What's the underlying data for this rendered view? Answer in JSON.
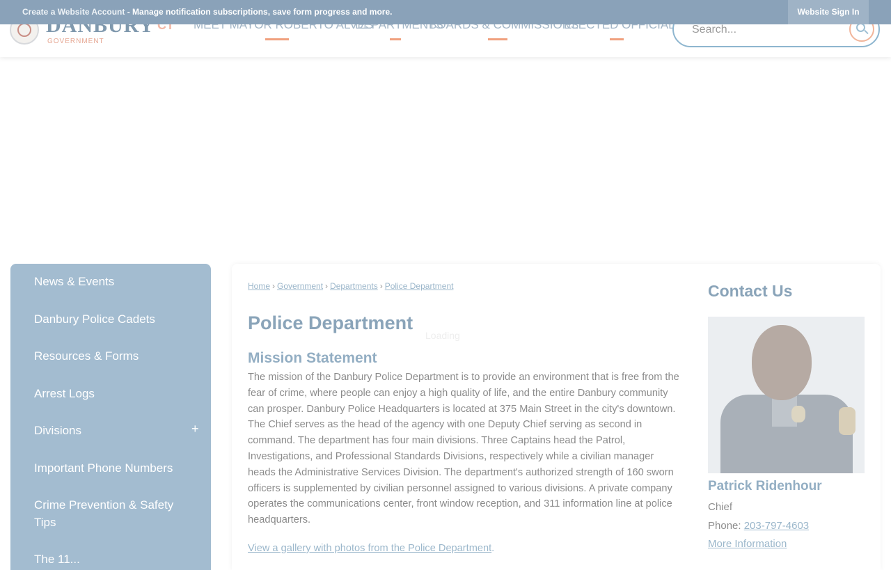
{
  "topbar": {
    "create_account": "Create a Website Account",
    "message": " - Manage notification subscriptions, save form progress and more.",
    "sign_in": "Website Sign In"
  },
  "header": {
    "logo": {
      "city": "DANBURY",
      "state": "CT",
      "sub": "GOVERNMENT"
    },
    "nav": [
      {
        "label": "MEET MAYOR ROBERTO ALVES"
      },
      {
        "label": "DEPARTMENTS"
      },
      {
        "label": "BOARDS & COMMISSIONS"
      },
      {
        "label": "ELECTED OFFICIALS"
      }
    ],
    "search": {
      "placeholder": "Search..."
    }
  },
  "sidebar": {
    "items": [
      {
        "label": "News & Events"
      },
      {
        "label": "Danbury Police Cadets"
      },
      {
        "label": "Resources & Forms"
      },
      {
        "label": "Arrest Logs"
      },
      {
        "label": "Divisions",
        "expand": "+"
      },
      {
        "label": "Important Phone Numbers"
      },
      {
        "label": "Crime Prevention & Safety Tips"
      },
      {
        "label": "The 11..."
      }
    ]
  },
  "breadcrumb": [
    "Home",
    "Government",
    "Departments",
    "Police Department"
  ],
  "loading_text": "Loading",
  "page": {
    "title": "Police Department",
    "mission_title": "Mission Statement",
    "mission_body": "The mission of the Danbury Police Department is to provide an environment that is free from the fear of crime, where people can enjoy a high quality of life, and the entire Danbury community can prosper. Danbury Police Headquarters is located at 375 Main Street in the city's downtown. The Chief serves as the head of the agency with one Deputy Chief serving as second in command. The department has four main divisions. Three Captains head the Patrol, Investigations, and Professional Standards Divisions, respectively while a civilian manager heads the Administrative Services Division. The department's authorized strength of 160 sworn officers is supplemented by civilian personnel assigned to various divisions. A private company operates the communications center, front window reception, and 311 information line at police headquarters.",
    "gallery_link": "View a gallery with photos from the Police Department",
    "gallery_suffix": "."
  },
  "contact": {
    "title": "Contact Us",
    "name": "Patrick Ridenhour",
    "role": "Chief",
    "phone_label": "Phone: ",
    "phone": "203-797-4603",
    "more": "More Information"
  }
}
